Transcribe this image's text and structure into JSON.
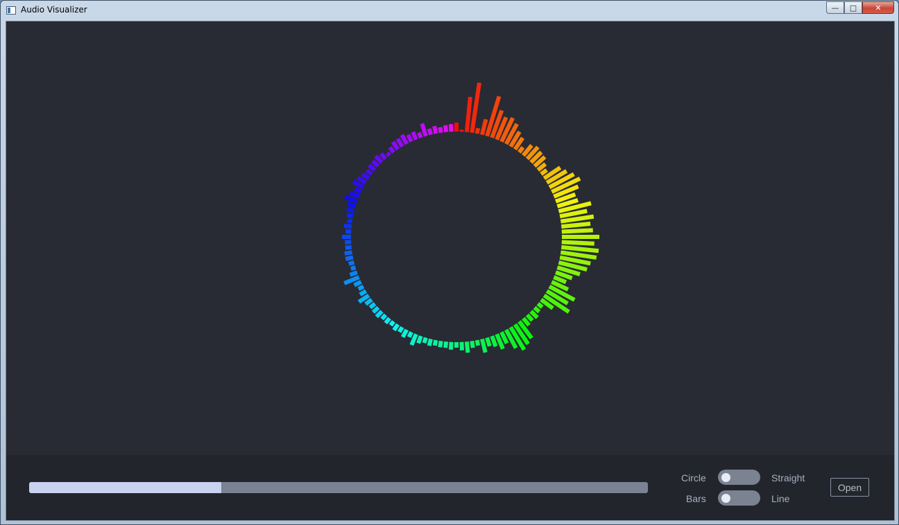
{
  "window": {
    "title": "Audio Visualizer",
    "controls": {
      "minimize": "—",
      "maximize": "□",
      "close": "✕"
    }
  },
  "visualizer": {
    "mode": "Circle",
    "style": "Bars",
    "bar_count": 128,
    "magnitudes": [
      13,
      0,
      51,
      73,
      8,
      23,
      60,
      42,
      35,
      38,
      33,
      25,
      20,
      9,
      19,
      23,
      21,
      20,
      14,
      10,
      28,
      33,
      40,
      45,
      38,
      30,
      31,
      48,
      40,
      48,
      42,
      45,
      54,
      47,
      54,
      52,
      45,
      42,
      34,
      25,
      19,
      26,
      41,
      35,
      43,
      21,
      8,
      9,
      13,
      11,
      13,
      30,
      34,
      38,
      30,
      18,
      23,
      16,
      13,
      20,
      8,
      10,
      16,
      12,
      8,
      11,
      9,
      9,
      8,
      10,
      8,
      11,
      17,
      8,
      12,
      8,
      10,
      7,
      9,
      8,
      11,
      10,
      9,
      11,
      17,
      10,
      8,
      11,
      23,
      11,
      7,
      8,
      11,
      11,
      9,
      9,
      13,
      8,
      11,
      7,
      9,
      11,
      12,
      19,
      14,
      10,
      17,
      14,
      11,
      9,
      11,
      11,
      13,
      10,
      5,
      9,
      13,
      13,
      15,
      11,
      12,
      8,
      19,
      9,
      11,
      8,
      10,
      11
    ],
    "colors": {
      "background": "#282b33"
    }
  },
  "progress": {
    "fraction": 0.31
  },
  "toggles": [
    {
      "left_label": "Circle",
      "right_label": "Straight",
      "on": false
    },
    {
      "left_label": "Bars",
      "right_label": "Line",
      "on": false
    }
  ],
  "open_button": {
    "label": "Open"
  }
}
